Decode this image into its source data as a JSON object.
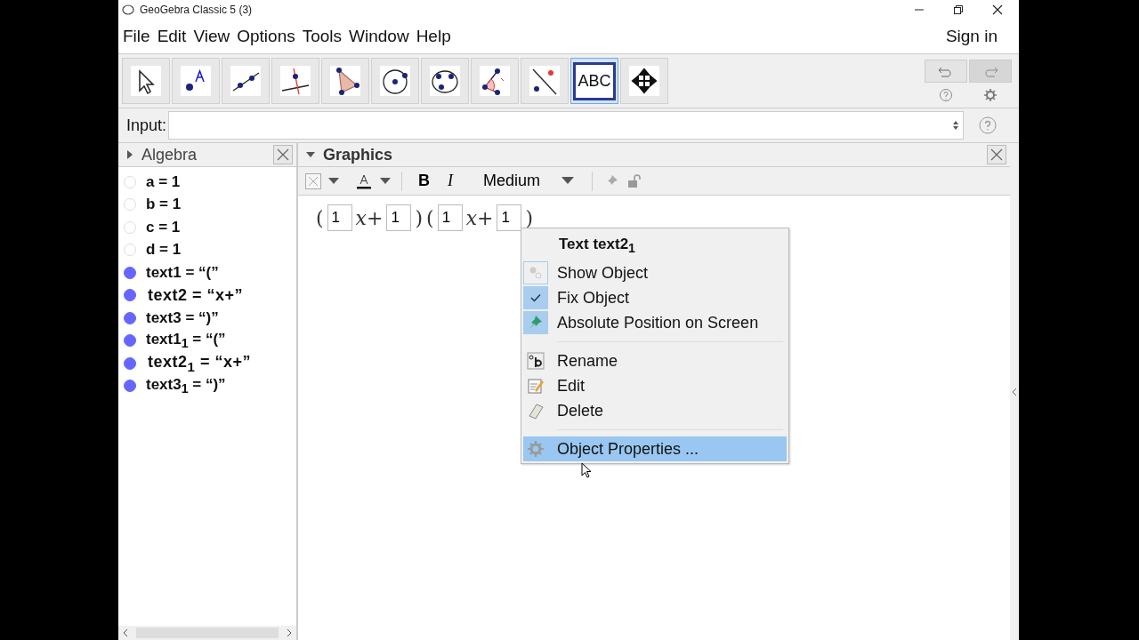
{
  "window": {
    "title": "GeoGebra Classic 5 (3)"
  },
  "menu": [
    "File",
    "Edit",
    "View",
    "Options",
    "Tools",
    "Window",
    "Help"
  ],
  "sign_in": "Sign in",
  "tools": [
    {
      "kind": "move",
      "selected": false
    },
    {
      "kind": "point",
      "selected": false
    },
    {
      "kind": "line",
      "selected": false
    },
    {
      "kind": "perpendicular",
      "selected": false
    },
    {
      "kind": "polygon",
      "selected": false
    },
    {
      "kind": "circle",
      "selected": false
    },
    {
      "kind": "conic",
      "selected": false
    },
    {
      "kind": "angle",
      "selected": false
    },
    {
      "kind": "reflect",
      "selected": false
    },
    {
      "kind": "text",
      "selected": true,
      "label": "ABC"
    },
    {
      "kind": "move-view",
      "selected": false
    }
  ],
  "input": {
    "label": "Input:"
  },
  "algebra": {
    "title": "Algebra",
    "items": [
      {
        "text": "a = 1",
        "visible": false,
        "kind": "plain"
      },
      {
        "text": "b = 1",
        "visible": false,
        "kind": "plain"
      },
      {
        "text": "c = 1",
        "visible": false,
        "kind": "plain"
      },
      {
        "text": "d = 1",
        "visible": false,
        "kind": "plain"
      },
      {
        "text": "text1 = “(”",
        "visible": true,
        "kind": "plain"
      },
      {
        "text": "text2 = “x+”",
        "visible": true,
        "kind": "latex"
      },
      {
        "text": "text3 = “)”",
        "visible": true,
        "kind": "plain"
      },
      {
        "text": "text1$_{1}$ = “(”",
        "visible": true,
        "kind": "plain"
      },
      {
        "text": "text2$_{1}$ = “x+”",
        "visible": true,
        "kind": "latex"
      },
      {
        "text": "text3$_{1}$ = “)”",
        "visible": true,
        "kind": "plain"
      }
    ]
  },
  "graphics": {
    "title": "Graphics",
    "style_bar": {
      "bold": "B",
      "italic": "I",
      "size": "Medium"
    },
    "formula": [
      {
        "kind": "paren",
        "text": "("
      },
      {
        "kind": "input",
        "text": "1"
      },
      {
        "kind": "math",
        "text": "x+"
      },
      {
        "kind": "input",
        "text": "1"
      },
      {
        "kind": "paren",
        "text": ")"
      },
      {
        "kind": "paren",
        "text": "("
      },
      {
        "kind": "input",
        "text": "1"
      },
      {
        "kind": "math",
        "text": "x+"
      },
      {
        "kind": "input",
        "text": "1"
      },
      {
        "kind": "paren",
        "text": ")"
      }
    ]
  },
  "context_menu": {
    "title": "Text text2$_{1}$",
    "items": [
      {
        "kind": "show",
        "label": "Show Object",
        "checked": false,
        "selected": false
      },
      {
        "kind": "check",
        "label": "Fix Object",
        "checked": true,
        "selected": false
      },
      {
        "kind": "pin",
        "label": "Absolute Position on Screen",
        "checked": true,
        "selected": false
      },
      {
        "kind": "separator"
      },
      {
        "kind": "rename",
        "label": "Rename",
        "checked": false,
        "selected": false
      },
      {
        "kind": "edit",
        "label": "Edit",
        "checked": false,
        "selected": false
      },
      {
        "kind": "delete",
        "label": "Delete",
        "checked": false,
        "selected": false
      },
      {
        "kind": "separator"
      },
      {
        "kind": "gear",
        "label": "Object Properties ...",
        "checked": false,
        "selected": true
      }
    ]
  }
}
